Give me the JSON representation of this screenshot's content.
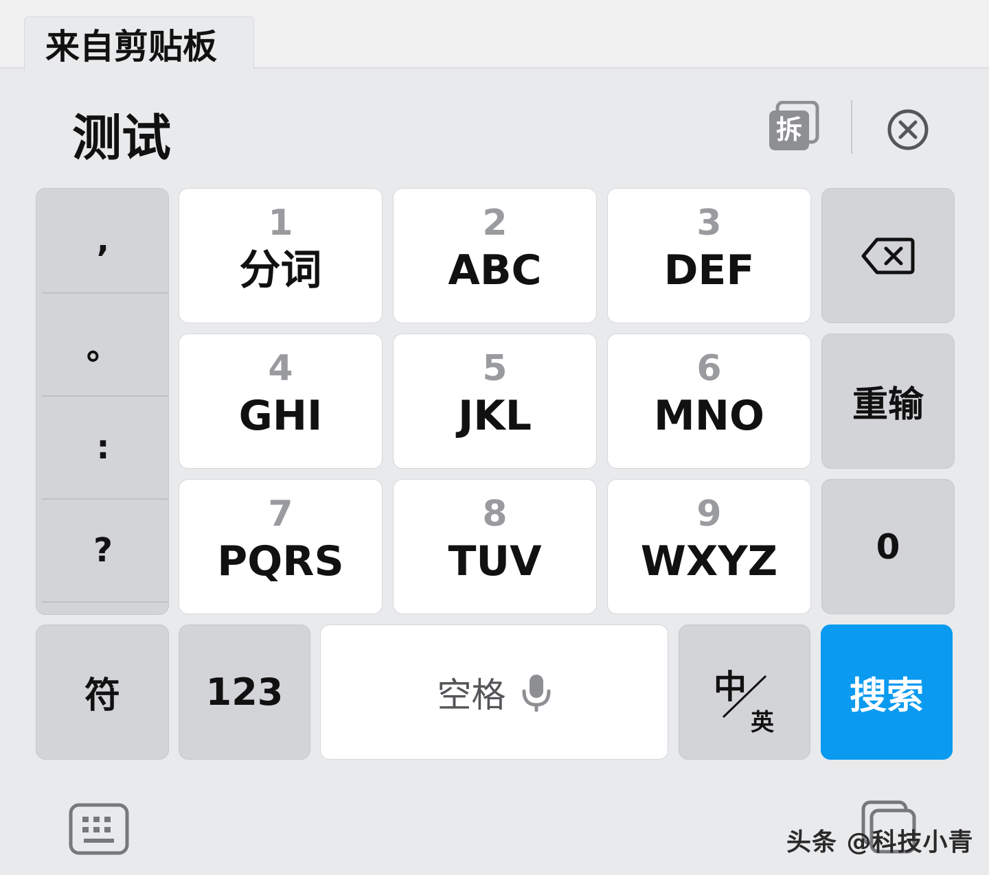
{
  "clipboard_tab": {
    "label": "来自剪贴板"
  },
  "candidate_bar": {
    "text": "测试"
  },
  "icons": {
    "split": "split-icon",
    "split_glyph": "拆",
    "close": "close-icon",
    "backspace": "backspace-icon",
    "microphone": "microphone-icon",
    "keyboard": "keyboard-icon",
    "clipboard": "clipboard-icon"
  },
  "punctuation": [
    ",",
    "。",
    ":",
    "?"
  ],
  "keys": [
    {
      "num": "1",
      "letters": "分词"
    },
    {
      "num": "2",
      "letters": "ABC"
    },
    {
      "num": "3",
      "letters": "DEF"
    },
    {
      "num": "4",
      "letters": "GHI"
    },
    {
      "num": "5",
      "letters": "JKL"
    },
    {
      "num": "6",
      "letters": "MNO"
    },
    {
      "num": "7",
      "letters": "PQRS"
    },
    {
      "num": "8",
      "letters": "TUV"
    },
    {
      "num": "9",
      "letters": "WXYZ"
    }
  ],
  "right_column": {
    "reinput": "重输",
    "zero": "0"
  },
  "bottom_row": {
    "symbols": "符",
    "numbers": "123",
    "space": "空格",
    "lang_zh": "中",
    "lang_en": "英",
    "search": "搜索"
  },
  "watermark": "头条 @科技小青",
  "colors": {
    "search_key": "#0a9af0",
    "keyboard_bg": "#e9eaec"
  }
}
